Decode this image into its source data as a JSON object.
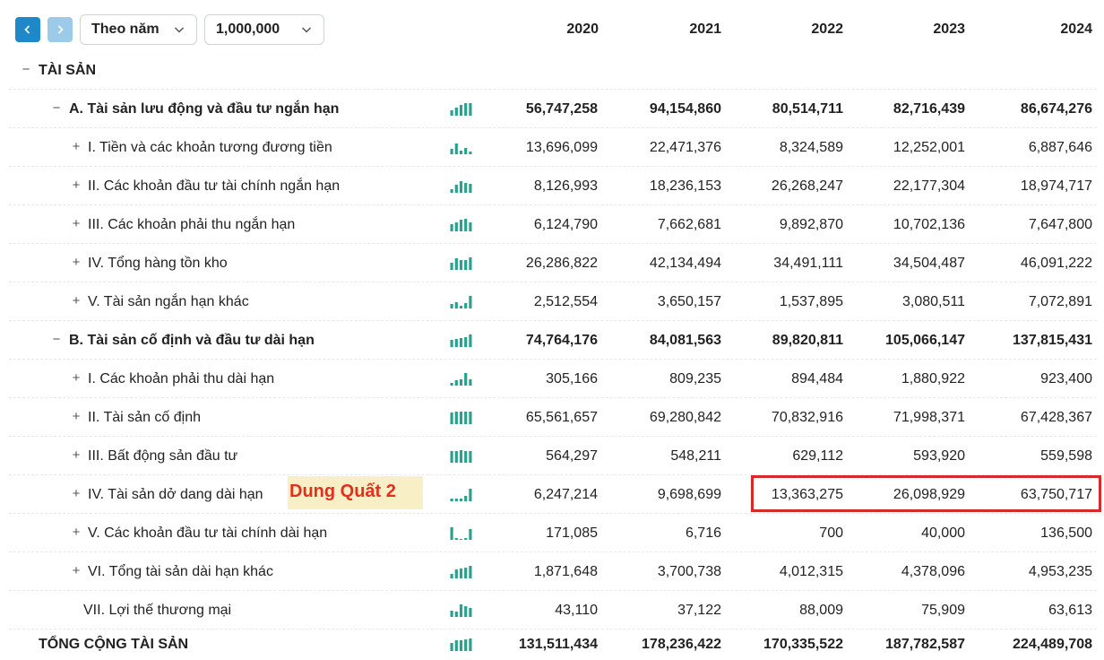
{
  "toolbar": {
    "prev_icon": "chevron-left-icon",
    "next_icon": "chevron-right-icon",
    "period_select": "Theo năm",
    "unit_select": "1,000,000"
  },
  "years": [
    "2020",
    "2021",
    "2022",
    "2023",
    "2024"
  ],
  "colors": {
    "accent": "#1e88c8",
    "spark": "#2aa18e",
    "highlight": "#d62a2a",
    "note_bg": "#f9efc6",
    "note_text": "#e0301e"
  },
  "annotation": {
    "note_text": "Dung Quất 2"
  },
  "rows": [
    {
      "toggle": "−",
      "label": "TÀI SẢN",
      "values": []
    },
    {
      "toggle": "−",
      "label": "A. Tài sản lưu động và đầu tư ngắn hạn",
      "values": [
        "56,747,258",
        "94,154,860",
        "80,514,711",
        "82,716,439",
        "86,674,276"
      ]
    },
    {
      "toggle": "+",
      "label": "I. Tiền và các khoản tương đương tiền",
      "values": [
        "13,696,099",
        "22,471,376",
        "8,324,589",
        "12,252,001",
        "6,887,646"
      ]
    },
    {
      "toggle": "+",
      "label": "II. Các khoản đầu tư tài chính ngắn hạn",
      "values": [
        "8,126,993",
        "18,236,153",
        "26,268,247",
        "22,177,304",
        "18,974,717"
      ]
    },
    {
      "toggle": "+",
      "label": "III. Các khoản phải thu ngắn hạn",
      "values": [
        "6,124,790",
        "7,662,681",
        "9,892,870",
        "10,702,136",
        "7,647,800"
      ]
    },
    {
      "toggle": "+",
      "label": "IV. Tổng hàng tồn kho",
      "values": [
        "26,286,822",
        "42,134,494",
        "34,491,111",
        "34,504,487",
        "46,091,222"
      ]
    },
    {
      "toggle": "+",
      "label": "V. Tài sản ngắn hạn khác",
      "values": [
        "2,512,554",
        "3,650,157",
        "1,537,895",
        "3,080,511",
        "7,072,891"
      ]
    },
    {
      "toggle": "−",
      "label": "B. Tài sản cố định và đầu tư dài hạn",
      "values": [
        "74,764,176",
        "84,081,563",
        "89,820,811",
        "105,066,147",
        "137,815,431"
      ]
    },
    {
      "toggle": "+",
      "label": "I. Các khoản phải thu dài hạn",
      "values": [
        "305,166",
        "809,235",
        "894,484",
        "1,880,922",
        "923,400"
      ]
    },
    {
      "toggle": "+",
      "label": "II. Tài sản cố định",
      "values": [
        "65,561,657",
        "69,280,842",
        "70,832,916",
        "71,998,371",
        "67,428,367"
      ]
    },
    {
      "toggle": "+",
      "label": "III. Bất động sản đầu tư",
      "values": [
        "564,297",
        "548,211",
        "629,112",
        "593,920",
        "559,598"
      ]
    },
    {
      "toggle": "+",
      "label": "IV. Tài sản dở dang dài hạn",
      "values": [
        "6,247,214",
        "9,698,699",
        "13,363,275",
        "26,098,929",
        "63,750,717"
      ]
    },
    {
      "toggle": "+",
      "label": "V. Các khoản đầu tư tài chính dài hạn",
      "values": [
        "171,085",
        "6,716",
        "700",
        "40,000",
        "136,500"
      ]
    },
    {
      "toggle": "+",
      "label": "VI. Tổng tài sản dài hạn khác",
      "values": [
        "1,871,648",
        "3,700,738",
        "4,012,315",
        "4,378,096",
        "4,953,235"
      ]
    },
    {
      "toggle": "",
      "label": "VII. Lợi thế thương mại",
      "values": [
        "43,110",
        "37,122",
        "88,009",
        "75,909",
        "63,613"
      ]
    },
    {
      "toggle": "",
      "label": "TỔNG CỘNG TÀI SẢN",
      "values": [
        "131,511,434",
        "178,236,422",
        "170,335,522",
        "187,782,587",
        "224,489,708"
      ]
    }
  ]
}
